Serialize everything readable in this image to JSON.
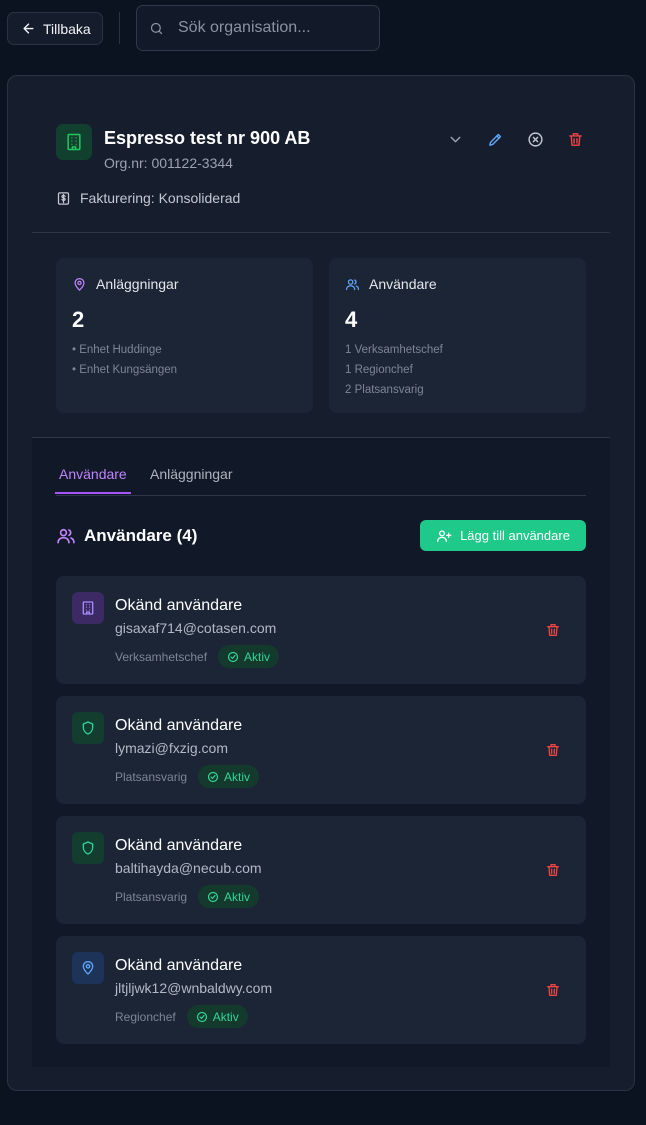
{
  "topbar": {
    "back_label": "Tillbaka",
    "search_placeholder": "Sök organisation..."
  },
  "org": {
    "name": "Espresso test nr 900 AB",
    "org_nr": "Org.nr: 001122-3344",
    "billing": "Fakturering: Konsoliderad",
    "icon": "building-icon",
    "accent_color": "#22c55e"
  },
  "stats": {
    "facilities": {
      "label": "Anläggningar",
      "count": "2",
      "items": [
        "• Enhet Huddinge",
        "• Enhet Kungsängen"
      ]
    },
    "users": {
      "label": "Användare",
      "count": "4",
      "items": [
        "1 Verksamhetschef",
        "1 Regionchef",
        "2 Platsansvarig"
      ]
    }
  },
  "tabs": [
    {
      "label": "Användare",
      "active": true
    },
    {
      "label": "Anläggningar",
      "active": false
    }
  ],
  "users_section": {
    "title": "Användare (4)",
    "add_label": "Lägg till användare",
    "add_color": "#1ec98a"
  },
  "users": [
    {
      "name": "Okänd användare",
      "email": "gisaxaf714@cotasen.com",
      "role": "Verksamhetschef",
      "status": "Aktiv",
      "icon": "building-icon"
    },
    {
      "name": "Okänd användare",
      "email": "lymazi@fxzig.com",
      "role": "Platsansvarig",
      "status": "Aktiv",
      "icon": "shield-icon"
    },
    {
      "name": "Okänd användare",
      "email": "baltihayda@necub.com",
      "role": "Platsansvarig",
      "status": "Aktiv",
      "icon": "shield-icon"
    },
    {
      "name": "Okänd användare",
      "email": "jltjljwk12@wnbaldwy.com",
      "role": "Regionchef",
      "status": "Aktiv",
      "icon": "map-pin-icon"
    }
  ]
}
